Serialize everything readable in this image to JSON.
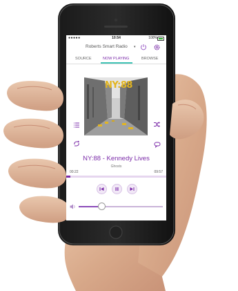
{
  "status_bar": {
    "carrier": "●●●●● ",
    "time": "10:54",
    "battery": "100%"
  },
  "header": {
    "device_name": "Roberts Smart Radio",
    "dropdown_icon": "chevron-down-icon",
    "power_icon": "power-icon",
    "settings_icon": "gear-icon"
  },
  "tabs": [
    {
      "label": "SOURCE"
    },
    {
      "label": "NOW PLAYING",
      "active": true
    },
    {
      "label": "BROWSE"
    }
  ],
  "album_art": {
    "text": "NY:88"
  },
  "side_controls": {
    "queue_icon": "list-icon",
    "shuffle_icon": "shuffle-icon",
    "favourite_icon": "repeat-icon",
    "chat_icon": "comment-icon"
  },
  "now_playing": {
    "title": "NY:88 - Kennedy Lives",
    "artist": "Ghosts",
    "elapsed": "00:22",
    "duration": "09:57",
    "progress_fraction": 0.04
  },
  "transport": {
    "prev_icon": "skip-previous-icon",
    "pause_icon": "pause-icon",
    "next_icon": "skip-next-icon"
  },
  "volume": {
    "icon": "speaker-icon",
    "level_fraction": 0.27
  },
  "colors": {
    "accent": "#7a2aa8",
    "tab_underline": "#3ec3b5",
    "album_text": "#e3b520"
  }
}
